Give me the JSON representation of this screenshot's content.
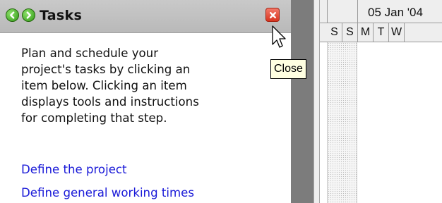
{
  "task_pane": {
    "title": "Tasks",
    "back_icon": "back-arrow-icon",
    "forward_icon": "forward-arrow-icon",
    "close_icon": "close-icon",
    "intro_text": "Plan and schedule your\nproject's tasks by clicking an\nitem below. Clicking an item\ndisplays tools and instructions\nfor completing that step.",
    "links": [
      {
        "label": "Define the project"
      },
      {
        "label": "Define general working times"
      }
    ]
  },
  "tooltip": {
    "text": "Close"
  },
  "gantt": {
    "week_label": "05 Jan '04",
    "days": [
      "S",
      "S",
      "M",
      "T",
      "W"
    ],
    "colors": {
      "nonworking_fill": "#f6f6f6",
      "header_bg": "#eeeeee",
      "splitter": "#7c7c7c"
    }
  },
  "colors": {
    "link": "#1a1ad8",
    "header_bg": "#c0c0c0",
    "close_red": "#d8341f",
    "nav_green": "#2f9a16",
    "tooltip_bg": "#ffffe1"
  }
}
